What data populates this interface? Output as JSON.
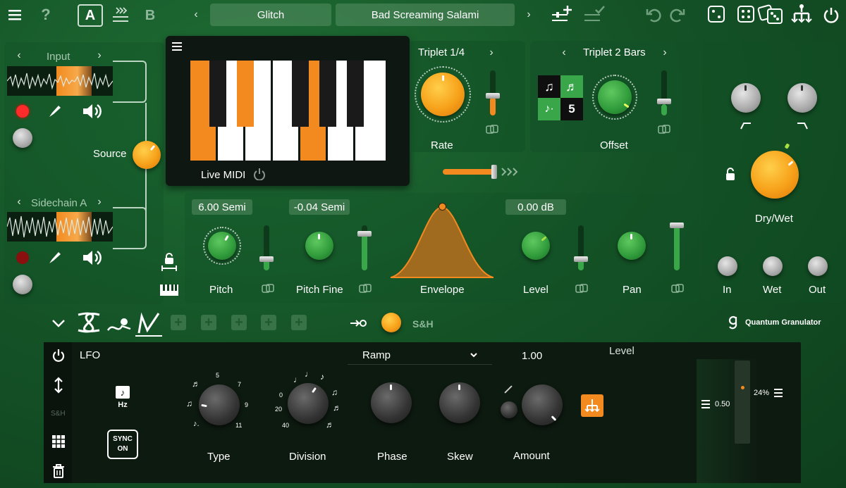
{
  "toolbar": {
    "slot_a": "A",
    "slot_b": "B",
    "preset_category": "Glitch",
    "preset_name": "Bad Screaming Salami"
  },
  "input": {
    "label": "Input",
    "sidechain_label": "Sidechain A",
    "source_label": "Source"
  },
  "keyboard": {
    "label": "Live MIDI"
  },
  "rate": {
    "title": "Triplet 1/4",
    "label": "Rate"
  },
  "offset": {
    "title": "Triplet 2 Bars",
    "label": "Offset",
    "badge_value": "5"
  },
  "mix": {
    "label": "Dry/Wet",
    "in_label": "In",
    "wet_label": "Wet",
    "out_label": "Out"
  },
  "pitch": {
    "value": "6.00 Semi",
    "label": "Pitch"
  },
  "pitch_fine": {
    "value": "-0.04 Semi",
    "label": "Pitch Fine"
  },
  "envelope": {
    "label": "Envelope"
  },
  "level": {
    "value": "0.00 dB",
    "label": "Level"
  },
  "pan": {
    "label": "Pan"
  },
  "mod_bar": {
    "sh_label": "S&H",
    "brand": "Quantum Granulator"
  },
  "lfo": {
    "title": "LFO",
    "hz_label": "Hz",
    "sync_label": "SYNC",
    "sync_state": "ON",
    "sh_side": "S&H",
    "shape": "Ramp",
    "amount_value": "1.00",
    "target_label": "Level",
    "type_label": "Type",
    "division_label": "Division",
    "phase_label": "Phase",
    "skew_label": "Skew",
    "amount_label": "Amount",
    "meter_left": "0.50",
    "meter_right": "24%",
    "type_scale": [
      "5",
      "7",
      "9",
      "11"
    ],
    "division_scale": [
      "0",
      "20",
      "40"
    ]
  },
  "colors": {
    "accent_orange": "#f28a1f",
    "accent_green": "#3aa64a",
    "background": "#155427"
  }
}
